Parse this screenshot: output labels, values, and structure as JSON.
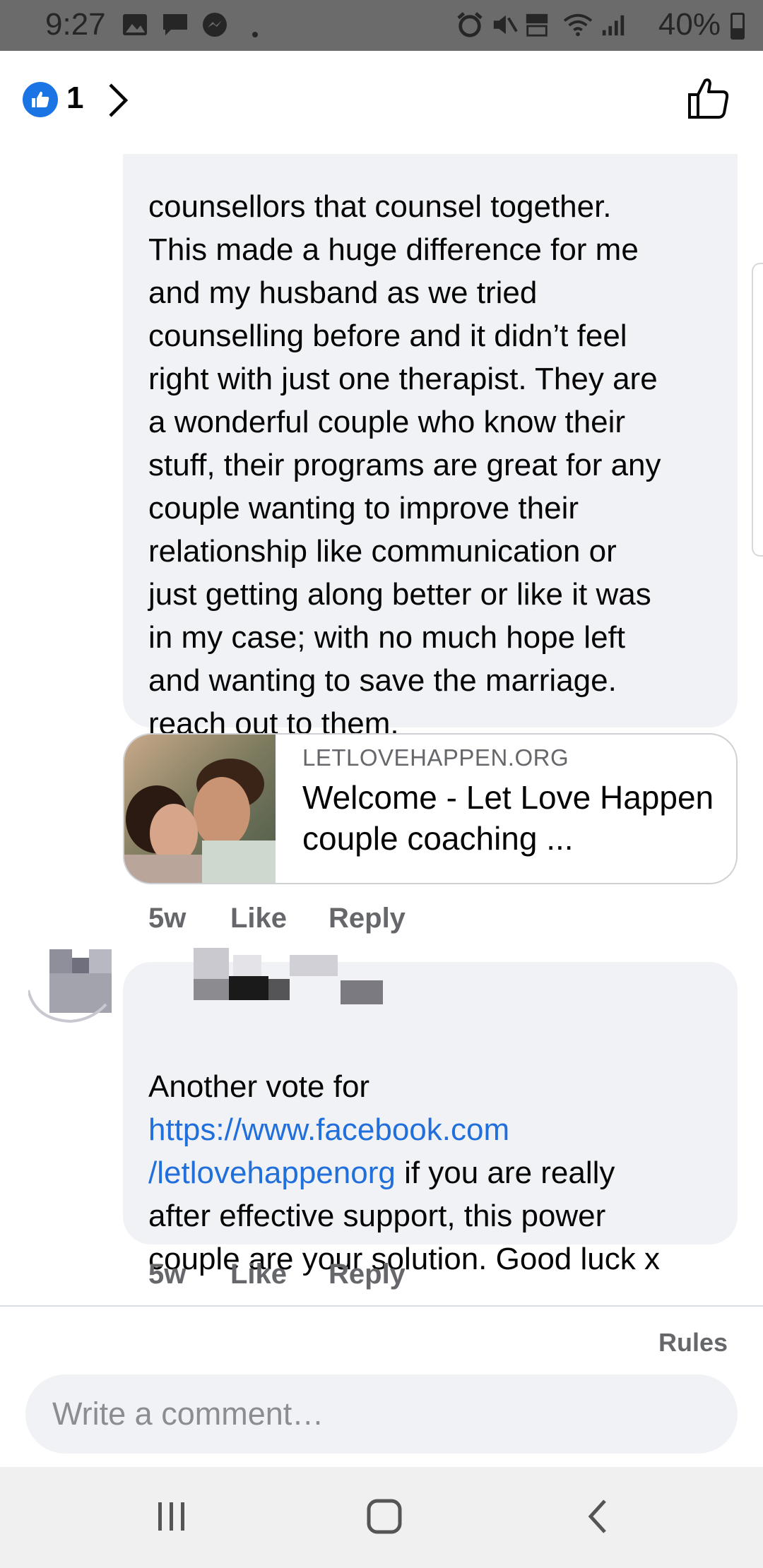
{
  "status_bar": {
    "time": "9:27",
    "battery": "40%"
  },
  "reactions": {
    "count": "1"
  },
  "comments": [
    {
      "text_lines": [
        "counsellors that counsel together.",
        "This made a huge difference for me",
        "and my husband as we tried",
        "counselling before and it didn’t feel",
        "right with just one therapist. They are",
        "a wonderful couple who know their",
        "stuff, their programs are great for any",
        "couple wanting to improve their",
        "relationship like communication or",
        "just getting along better or like it was",
        "in my case; with no much hope left",
        "and wanting to save the marriage.",
        "reach out to them."
      ],
      "link_preview": {
        "domain": "LETLOVEHAPPEN.ORG",
        "title": "Welcome - Let Love Happen couple coaching ..."
      },
      "time": "5w",
      "like_label": "Like",
      "reply_label": "Reply"
    },
    {
      "text_line1": "Another vote for",
      "link_line1": "https://www.facebook.com",
      "link_line2": "/letlovehappenorg",
      "text_after_link": " if you are really",
      "text_line4": "after effective support, this power",
      "text_line5": "couple are your solution. Good luck x",
      "time": "5w",
      "like_label": "Like",
      "reply_label": "Reply"
    }
  ],
  "footer": {
    "rules_label": "Rules",
    "composer_placeholder": "Write a comment…"
  },
  "colors": {
    "like_blue": "#1b74e4",
    "link_blue": "#216fdb",
    "bubble_bg": "#f0f2f5",
    "meta_gray": "#65676b"
  },
  "icons": [
    "like-reaction-icon",
    "chevron-right-icon",
    "thumbs-up-icon",
    "recents-icon",
    "home-icon",
    "back-icon"
  ]
}
